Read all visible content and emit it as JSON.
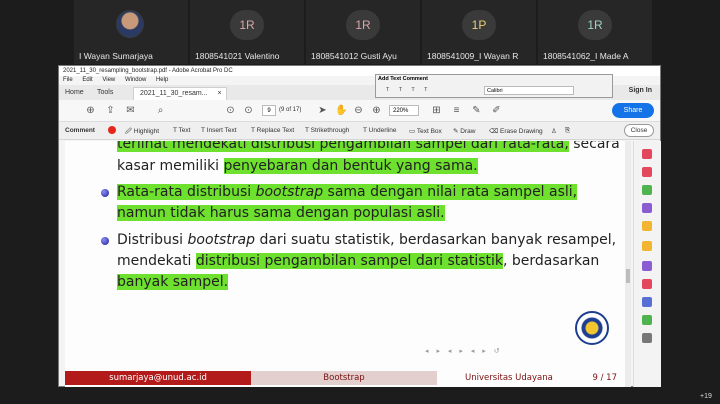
{
  "participants": [
    {
      "name": "I Wayan Sumarjaya",
      "initials": "",
      "initials_color": ""
    },
    {
      "name": "1808541021 Valentino",
      "initials": "1R",
      "initials_color": "#d8a8a8"
    },
    {
      "name": "1808541012 Gusti Ayu",
      "initials": "1R",
      "initials_color": "#d8a8a8"
    },
    {
      "name": "1808541009_I Wayan R",
      "initials": "1P",
      "initials_color": "#e6d07a"
    },
    {
      "name": "1808541062_I Made A",
      "initials": "1R",
      "initials_color": "#9fd4bf"
    }
  ],
  "window": {
    "title": "2021_11_30_resampling_bootstrap.pdf - Adobe Acrobat Pro DC",
    "menu": [
      "File",
      "Edit",
      "View",
      "Window",
      "Help"
    ],
    "tabs": {
      "home": "Home",
      "tools": "Tools",
      "document": "2021_11_30_resam...",
      "close": "×"
    },
    "sign_in": "Sign In"
  },
  "toolbar": {
    "page_current": "9",
    "page_count": "(9 of 17)",
    "zoom": "220%",
    "share": "Share"
  },
  "add_text_comment": {
    "title": "Add Text Comment",
    "font": "Calibri"
  },
  "comment_bar": {
    "label": "Comment",
    "tools": [
      "Highlight",
      "Text",
      "Insert Text",
      "Replace Text",
      "Strikethrough",
      "Underline",
      "Text Box",
      "Draw",
      "Erase Drawing"
    ],
    "close": "Close"
  },
  "slide": {
    "line0_hl": "terlihat mendekati distribusi pengambilan sampel dari rata-rata,",
    "line0_rest": " secara",
    "line1_pre": "kasar memiliki ",
    "line1_hl": "penyebaran dan bentuk yang sama.",
    "b1_pre": "Rata-rata distribusi ",
    "b1_it": "bootstrap",
    "b1_rest": " sama dengan nilai rata sampel asli,",
    "b1_line2": "namun tidak harus sama dengan populasi asli.",
    "b2_pre": "Distribusi ",
    "b2_it": "bootstrap",
    "b2_rest": " dari suatu statistik, berdasarkan banyak resampel,",
    "b2_line2_pre": "mendekati ",
    "b2_line2_hl": "distribusi pengambilan sampel dari statistik",
    "b2_line2_rest": ", berdasarkan",
    "b2_line3": "banyak sampel.",
    "footer_email": "sumarjaya@unud.ac.id",
    "footer_title": "Bootstrap",
    "footer_uni": "Universitas Udayana",
    "footer_page": "9 / 17"
  },
  "extra_participants": "+19"
}
